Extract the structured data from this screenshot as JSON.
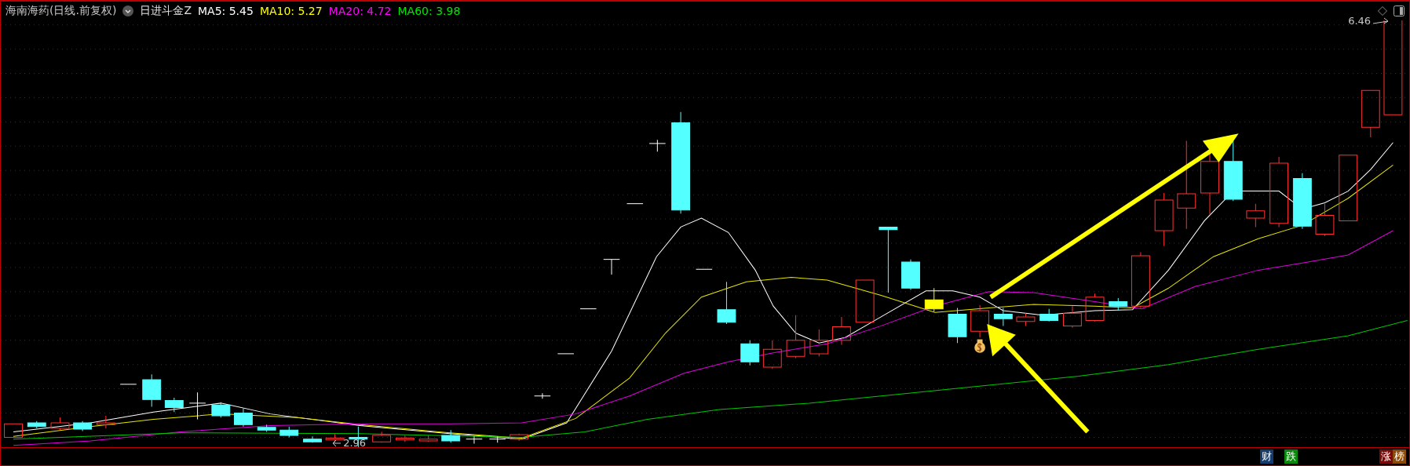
{
  "header": {
    "title": "海南海药(日线.前复权)",
    "formula": "日进斗金Z",
    "indicators": [
      {
        "label": "MA5: 5.45",
        "color": "#ffffff"
      },
      {
        "label": "MA10: 5.27",
        "color": "#ffff00"
      },
      {
        "label": "MA20: 4.72",
        "color": "#ff00ff"
      },
      {
        "label": "MA60: 3.98",
        "color": "#00e600"
      }
    ]
  },
  "price_labels": [
    {
      "kind": "high",
      "text": "6.46"
    },
    {
      "kind": "low",
      "text": "2.96"
    }
  ],
  "footer": {
    "left_tags": [
      {
        "label": "财",
        "color": "#123d6e"
      },
      {
        "label": "跌",
        "color": "#0a8a0a"
      }
    ],
    "right_tags": [
      {
        "label": "涨",
        "color": "#7a0a0a"
      },
      {
        "label": "榜",
        "color": "#8a4a0a"
      }
    ]
  }
}
